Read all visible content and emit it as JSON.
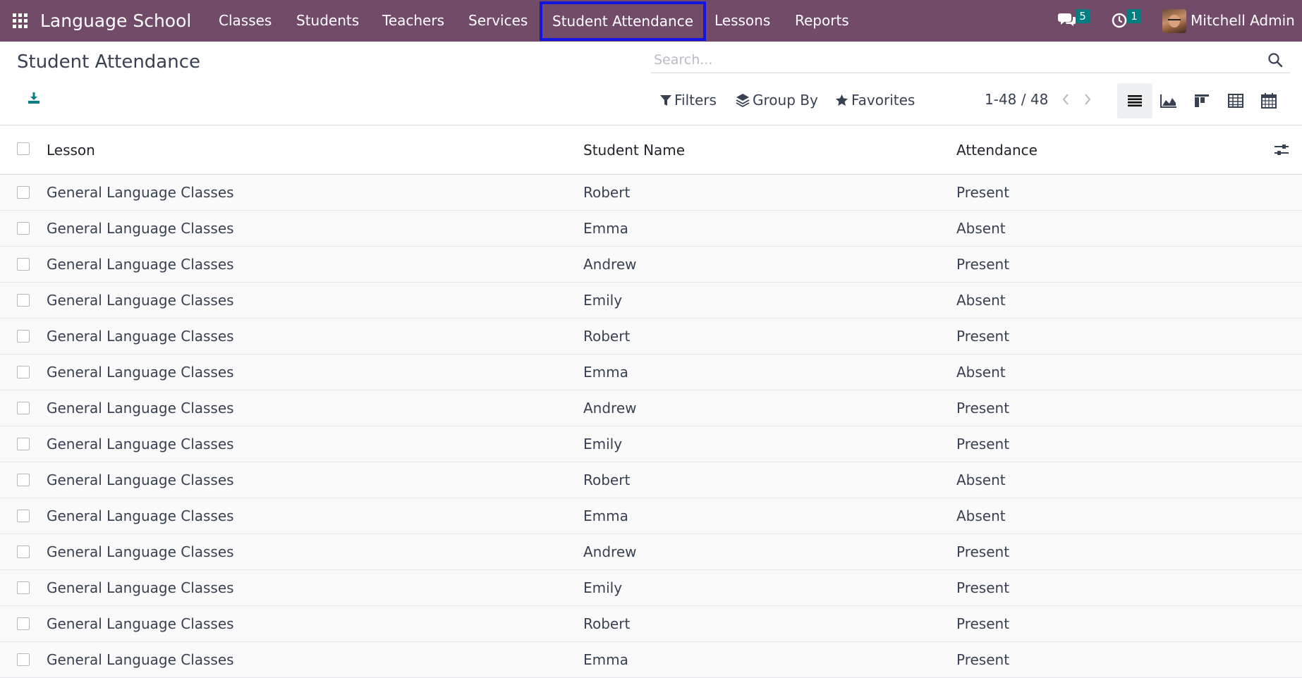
{
  "navbar": {
    "brand": "Language School",
    "menu": [
      {
        "label": "Classes"
      },
      {
        "label": "Students"
      },
      {
        "label": "Teachers"
      },
      {
        "label": "Services"
      },
      {
        "label": "Student Attendance"
      },
      {
        "label": "Lessons"
      },
      {
        "label": "Reports"
      }
    ],
    "messages_count": "5",
    "activities_count": "1",
    "user_name": "Mitchell Admin"
  },
  "control_panel": {
    "title": "Student Attendance",
    "search_placeholder": "Search...",
    "filters_label": "Filters",
    "group_by_label": "Group By",
    "favorites_label": "Favorites",
    "pager": "1-48 / 48"
  },
  "table": {
    "headers": {
      "lesson": "Lesson",
      "student": "Student Name",
      "attendance": "Attendance"
    },
    "rows": [
      {
        "lesson": "General Language Classes",
        "student": "Robert",
        "attendance": "Present"
      },
      {
        "lesson": "General Language Classes",
        "student": "Emma",
        "attendance": "Absent"
      },
      {
        "lesson": "General Language Classes",
        "student": "Andrew",
        "attendance": "Present"
      },
      {
        "lesson": "General Language Classes",
        "student": "Emily",
        "attendance": "Absent"
      },
      {
        "lesson": "General Language Classes",
        "student": "Robert",
        "attendance": "Present"
      },
      {
        "lesson": "General Language Classes",
        "student": "Emma",
        "attendance": "Absent"
      },
      {
        "lesson": "General Language Classes",
        "student": "Andrew",
        "attendance": "Present"
      },
      {
        "lesson": "General Language Classes",
        "student": "Emily",
        "attendance": "Present"
      },
      {
        "lesson": "General Language Classes",
        "student": "Robert",
        "attendance": "Absent"
      },
      {
        "lesson": "General Language Classes",
        "student": "Emma",
        "attendance": "Absent"
      },
      {
        "lesson": "General Language Classes",
        "student": "Andrew",
        "attendance": "Present"
      },
      {
        "lesson": "General Language Classes",
        "student": "Emily",
        "attendance": "Present"
      },
      {
        "lesson": "General Language Classes",
        "student": "Robert",
        "attendance": "Present"
      },
      {
        "lesson": "General Language Classes",
        "student": "Emma",
        "attendance": "Present"
      }
    ]
  },
  "icons": [
    "apps-grid-icon",
    "chat-icon",
    "clock-icon",
    "download-icon",
    "search-icon",
    "filter-icon",
    "layers-icon",
    "star-icon",
    "chevron-left-icon",
    "chevron-right-icon",
    "list-view-icon",
    "graph-view-icon",
    "kanban-view-icon",
    "pivot-view-icon",
    "calendar-view-icon",
    "column-settings-icon"
  ],
  "colors": {
    "navbar": "#714b67",
    "badge": "#017e84",
    "active_outline": "#1515e0",
    "accent": "#017e84"
  }
}
